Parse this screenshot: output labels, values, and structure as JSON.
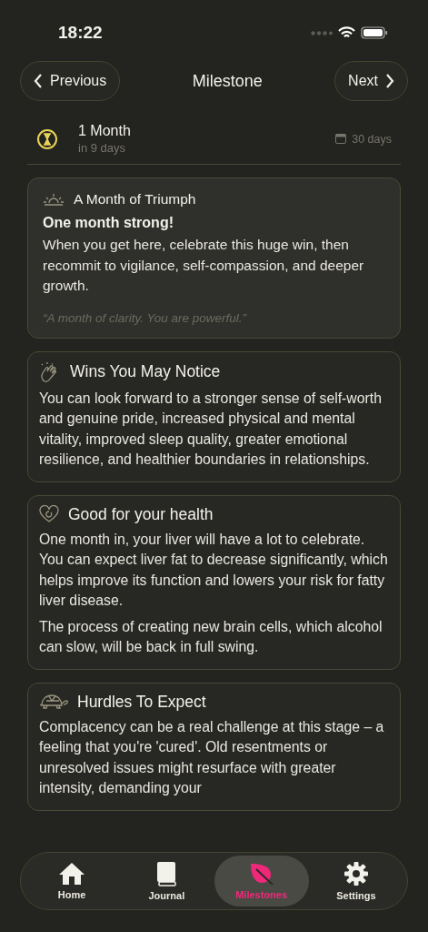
{
  "status_bar": {
    "time": "18:22"
  },
  "header": {
    "previous": "Previous",
    "title": "Milestone",
    "next": "Next"
  },
  "milestone": {
    "title": "1 Month",
    "subtitle": "in 9 days",
    "duration": "30 days"
  },
  "cards": [
    {
      "kind": "intro",
      "title": "A Month of Triumph",
      "headline": "One month strong!",
      "paragraphs": [
        "When you get here, celebrate this huge win, then recommit to vigilance, self-compassion, and deeper growth."
      ],
      "quote": "“A month of clarity. You are powerful.”"
    },
    {
      "kind": "section",
      "title": "Wins You May Notice",
      "paragraphs": [
        "You can look forward to a stronger sense of self-worth and genuine pride, increased physical and mental vitality, improved sleep quality, greater emotional resilience, and healthier boundaries in relationships."
      ]
    },
    {
      "kind": "section",
      "title": "Good for your health",
      "paragraphs": [
        "One month in, your liver will have a lot to celebrate. You can expect liver fat to decrease significantly, which helps improve its function and lowers your risk for fatty liver disease.",
        "The process of creating new brain cells, which alcohol can slow, will be back in full swing."
      ]
    },
    {
      "kind": "section",
      "title": "Hurdles To Expect",
      "paragraphs": [
        "Complacency can be a real challenge at this stage – a feeling that you're 'cured'. Old resentments or unresolved issues might resurface with greater intensity, demanding your"
      ]
    }
  ],
  "tabs": [
    {
      "label": "Home",
      "selected": false
    },
    {
      "label": "Journal",
      "selected": false
    },
    {
      "label": "Milestones",
      "selected": true
    },
    {
      "label": "Settings",
      "selected": false
    }
  ]
}
